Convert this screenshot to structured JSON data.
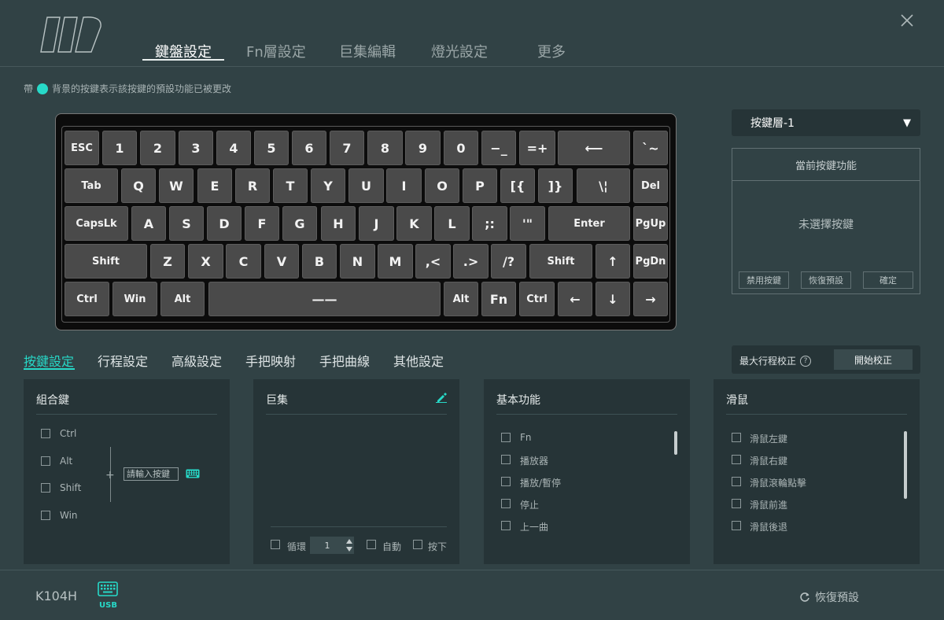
{
  "colors": {
    "accent": "#27d9c8",
    "background": "#314245",
    "panel": "#263437"
  },
  "nav": {
    "tabs": [
      {
        "label": "鍵盤設定",
        "active": true
      },
      {
        "label": "Fn層設定"
      },
      {
        "label": "巨集編輯"
      },
      {
        "label": "燈光設定"
      },
      {
        "label": "更多"
      }
    ]
  },
  "hint": {
    "prefix": "帶",
    "text": "背景的按鍵表示該按鍵的預設功能已被更改"
  },
  "keyboard": {
    "rows": [
      [
        "ESC",
        "1",
        "2",
        "3",
        "4",
        "5",
        "6",
        "7",
        "8",
        "9",
        "0",
        "−_",
        "=+",
        "⟵",
        "`~"
      ],
      [
        "Tab",
        "Q",
        "W",
        "E",
        "R",
        "T",
        "Y",
        "U",
        "I",
        "O",
        "P",
        "[{",
        "]}",
        "\\¦",
        "Del"
      ],
      [
        "CapsLk",
        "A",
        "S",
        "D",
        "F",
        "G",
        "H",
        "J",
        "K",
        "L",
        ";:",
        "'\"",
        "Enter",
        "PgUp"
      ],
      [
        "Shift",
        "Z",
        "X",
        "C",
        "V",
        "B",
        "N",
        "M",
        ",<",
        ".>",
        "/?",
        "Shift",
        "↑",
        "PgDn"
      ],
      [
        "Ctrl",
        "Win",
        "Alt",
        "——",
        "Alt",
        "Fn",
        "Ctrl",
        "←",
        "↓",
        "→"
      ]
    ]
  },
  "right_panel": {
    "layer_select": "按鍵層-1",
    "func_title": "當前按鍵功能",
    "func_empty": "未選擇按鍵",
    "buttons": [
      "禁用按鍵",
      "恢復預設",
      "確定"
    ]
  },
  "subtabs": [
    {
      "label": "按鍵設定",
      "active": true
    },
    {
      "label": "行程設定"
    },
    {
      "label": "高級設定"
    },
    {
      "label": "手把映射"
    },
    {
      "label": "手把曲線"
    },
    {
      "label": "其他設定"
    }
  ],
  "calibration": {
    "label": "最大行程校正",
    "help": "?",
    "button": "開始校正"
  },
  "combo_panel": {
    "title": "組合鍵",
    "modifiers": [
      "Ctrl",
      "Alt",
      "Shift",
      "Win"
    ],
    "plus": "+",
    "input_placeholder": "請輸入按鍵",
    "icon": "keyboard-icon"
  },
  "macro_panel": {
    "title": "巨集",
    "edit_icon": "pencil-icon",
    "loop_label": "循環",
    "count": "1",
    "auto_label": "自動",
    "press_label": "按下"
  },
  "basic_panel": {
    "title": "基本功能",
    "items": [
      "Fn",
      "播放器",
      "播放/暫停",
      "停止",
      "上一曲"
    ],
    "scroll_fraction": 0.12
  },
  "mouse_panel": {
    "title": "滑鼠",
    "items": [
      "滑鼠左鍵",
      "滑鼠右鍵",
      "滑鼠滾輪點擊",
      "滑鼠前進",
      "滑鼠後退"
    ],
    "scroll_fraction": 0.35
  },
  "footer": {
    "model": "K104H",
    "usb": "USB",
    "reset": "恢復預設"
  }
}
